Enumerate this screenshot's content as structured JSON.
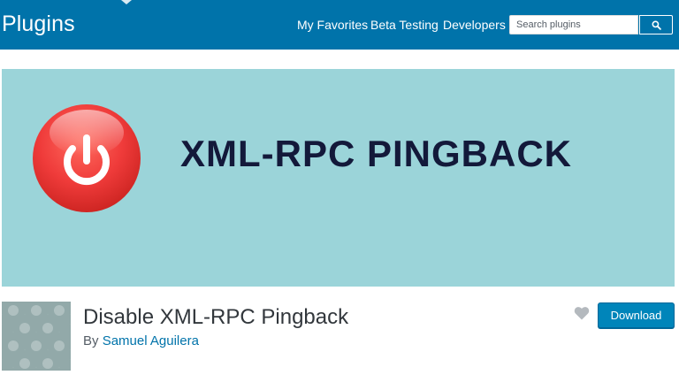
{
  "header": {
    "site_title": "Plugins",
    "nav": [
      {
        "label": "My Favorites"
      },
      {
        "label": "Beta Testing"
      },
      {
        "label": "Developers"
      }
    ],
    "search": {
      "placeholder": "Search plugins",
      "button_icon": "search-icon"
    },
    "color": "#0073aa"
  },
  "banner": {
    "title": "XML-RPC PINGBACK",
    "background_color": "#9bd4d9",
    "logo_icon": "power-icon",
    "logo_color": "#ef3b3a"
  },
  "plugin": {
    "name": "Disable XML-RPC Pingback",
    "author_prefix": "By",
    "author_name": "Samuel Aguilera",
    "favorite_icon": "heart-icon",
    "download_label": "Download",
    "download_color": "#0085ba"
  }
}
